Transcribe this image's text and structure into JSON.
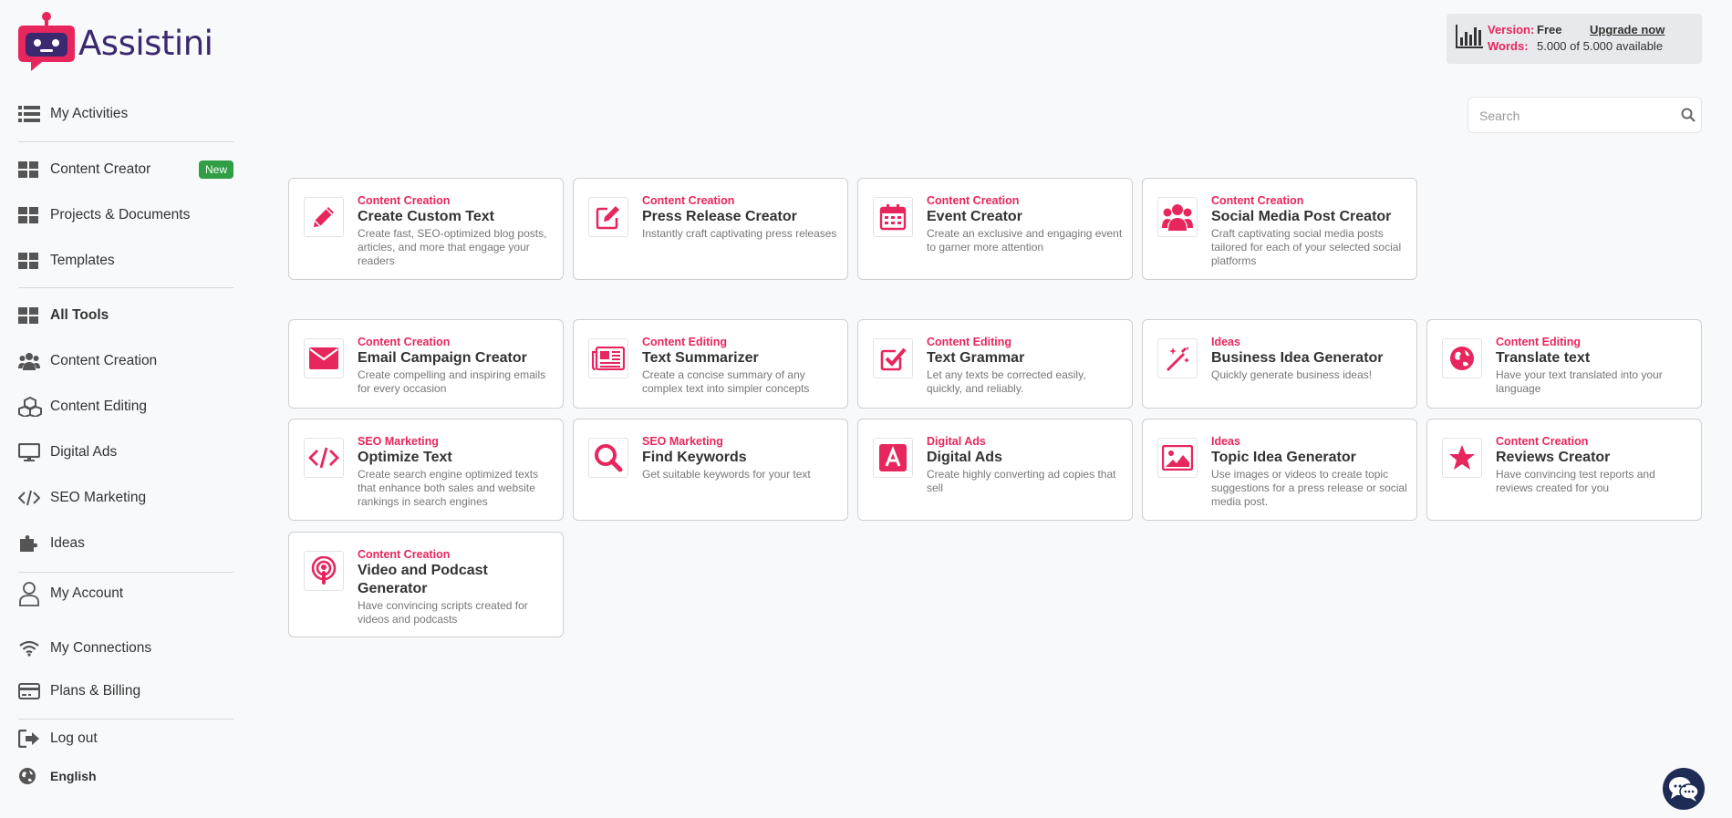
{
  "brand": {
    "name": "Assistini",
    "accent": "#e8265e",
    "logo_color": "#3b2970"
  },
  "plan": {
    "version_label": "Version:",
    "version_value": "Free",
    "upgrade_label": "Upgrade now",
    "words_label": "Words:",
    "words_value": "5.000 of 5.000 available"
  },
  "search": {
    "placeholder": "Search"
  },
  "sidebar": {
    "items": [
      {
        "label": "My Activities",
        "icon": "list-icon"
      },
      {
        "label": "Content Creator",
        "icon": "grid-icon",
        "badge": "New"
      },
      {
        "label": "Projects & Documents",
        "icon": "grid-icon"
      },
      {
        "label": "Templates",
        "icon": "grid-icon"
      },
      {
        "label": "All Tools",
        "icon": "grid-icon"
      },
      {
        "label": "Content Creation",
        "icon": "users-icon"
      },
      {
        "label": "Content Editing",
        "icon": "cubes-icon"
      },
      {
        "label": "Digital Ads",
        "icon": "monitor-icon"
      },
      {
        "label": "SEO Marketing",
        "icon": "code-icon"
      },
      {
        "label": "Ideas",
        "icon": "puzzle-icon"
      },
      {
        "label": "My Account",
        "icon": "user-icon"
      },
      {
        "label": "My Connections",
        "icon": "wifi-icon"
      },
      {
        "label": "Plans & Billing",
        "icon": "credit-card-icon"
      },
      {
        "label": "Log out",
        "icon": "logout-icon"
      },
      {
        "label": "English",
        "icon": "globe-icon"
      }
    ]
  },
  "tools": [
    {
      "category": "Content Creation",
      "title": "Create Custom Text",
      "desc": "Create fast, SEO-optimized blog posts, articles, and more that engage your readers",
      "icon": "pencil-icon"
    },
    {
      "category": "Content Creation",
      "title": "Press Release Creator",
      "desc": "Instantly craft captivating press releases",
      "icon": "edit-icon"
    },
    {
      "category": "Content Creation",
      "title": "Event Creator",
      "desc": "Create an exclusive and engaging event to garner more attention",
      "icon": "calendar-icon"
    },
    {
      "category": "Content Creation",
      "title": "Social Media Post Creator",
      "desc": "Craft captivating social media posts tailored for each of your selected social platforms",
      "icon": "users-icon"
    },
    {
      "category": "Content Creation",
      "title": "Email Campaign Creator",
      "desc": "Create compelling and inspiring emails for every occasion",
      "icon": "envelope-icon"
    },
    {
      "category": "Content Editing",
      "title": "Text Summarizer",
      "desc": "Create a concise summary of any complex text into simpler concepts",
      "icon": "newspaper-icon"
    },
    {
      "category": "Content Editing",
      "title": "Text Grammar",
      "desc": "Let any texts be corrected easily, quickly, and reliably.",
      "icon": "check-square-icon"
    },
    {
      "category": "Ideas",
      "title": "Business Idea Generator",
      "desc": "Quickly generate business ideas!",
      "icon": "magic-wand-icon"
    },
    {
      "category": "Content Editing",
      "title": "Translate text",
      "desc": "Have your text translated into your language",
      "icon": "globe-icon"
    },
    {
      "category": "SEO Marketing",
      "title": "Optimize Text",
      "desc": "Create search engine optimized texts that enhance both sales and website rankings in search engines",
      "icon": "code-icon"
    },
    {
      "category": "SEO Marketing",
      "title": "Find Keywords",
      "desc": "Get suitable keywords for your text",
      "icon": "search-icon"
    },
    {
      "category": "Digital Ads",
      "title": "Digital Ads",
      "desc": "Create highly converting ad copies that sell",
      "icon": "ad-icon"
    },
    {
      "category": "Ideas",
      "title": "Topic Idea Generator",
      "desc": "Use images or videos to create topic suggestions for a press release or social media post.",
      "icon": "image-icon"
    },
    {
      "category": "Content Creation",
      "title": "Reviews Creator",
      "desc": "Have convincing test reports and reviews created for you",
      "icon": "star-icon"
    },
    {
      "category": "Content Creation",
      "title": "Video and Podcast Generator",
      "desc": "Have convincing scripts created for videos and podcasts",
      "icon": "podcast-icon"
    }
  ]
}
